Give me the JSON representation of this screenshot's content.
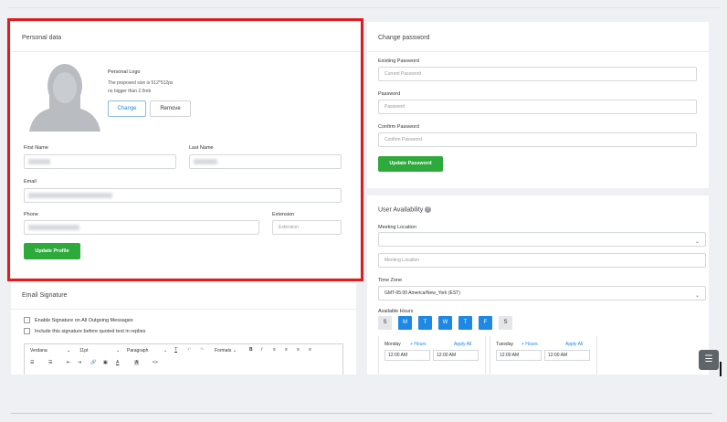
{
  "personal": {
    "title": "Personal data",
    "logo_label": "Personal Logo",
    "logo_size_hint": "The proposed size is 512*512px",
    "logo_weight_hint": "no bigger than 2.5mb",
    "change_label": "Change",
    "remove_label": "Remove",
    "first_name_label": "First Name",
    "last_name_label": "Last Name",
    "email_label": "Email",
    "phone_label": "Phone",
    "extension_label": "Extension",
    "extension_placeholder": "Extension",
    "update_label": "Update Profile"
  },
  "password": {
    "title": "Change password",
    "existing_label": "Existing Password",
    "existing_placeholder": "Current Password",
    "password_label": "Password",
    "password_placeholder": "Password",
    "confirm_label": "Confirm Password",
    "confirm_placeholder": "Confirm Password",
    "update_label": "Update Password"
  },
  "availability": {
    "title": "User Availability",
    "meeting_location_label": "Meeting Location",
    "meeting_location_placeholder": "Meeting Location",
    "time_zone_label": "Time Zone",
    "time_zone_value": "GMT-05:00 America/New_York (EST)",
    "available_hours_label": "Available Hours",
    "days": [
      {
        "letter": "S",
        "on": false
      },
      {
        "letter": "M",
        "on": true
      },
      {
        "letter": "T",
        "on": true
      },
      {
        "letter": "W",
        "on": true
      },
      {
        "letter": "T",
        "on": true
      },
      {
        "letter": "F",
        "on": true
      },
      {
        "letter": "S",
        "on": false
      }
    ],
    "monday": {
      "name": "Monday",
      "add": "+ Hours",
      "apply": "Apply All",
      "from": "12:00 AM",
      "to": "12:00 AM"
    },
    "tuesday": {
      "name": "Tuesday",
      "add": "+ Hours",
      "apply": "Apply All",
      "from": "12:00 AM",
      "to": "12:00 AM"
    }
  },
  "signature": {
    "title": "Email Signature",
    "enable_label": "Enable Signature on All Outgoing Messages",
    "include_label": "Include this signature before quoted text in replies",
    "font": "Verdana",
    "size": "11pt",
    "block": "Paragraph",
    "formats": "Formats"
  },
  "colors": {
    "accent_green": "#2eaa3c",
    "accent_blue": "#1e88e5",
    "highlight_red": "#e01c1c"
  }
}
